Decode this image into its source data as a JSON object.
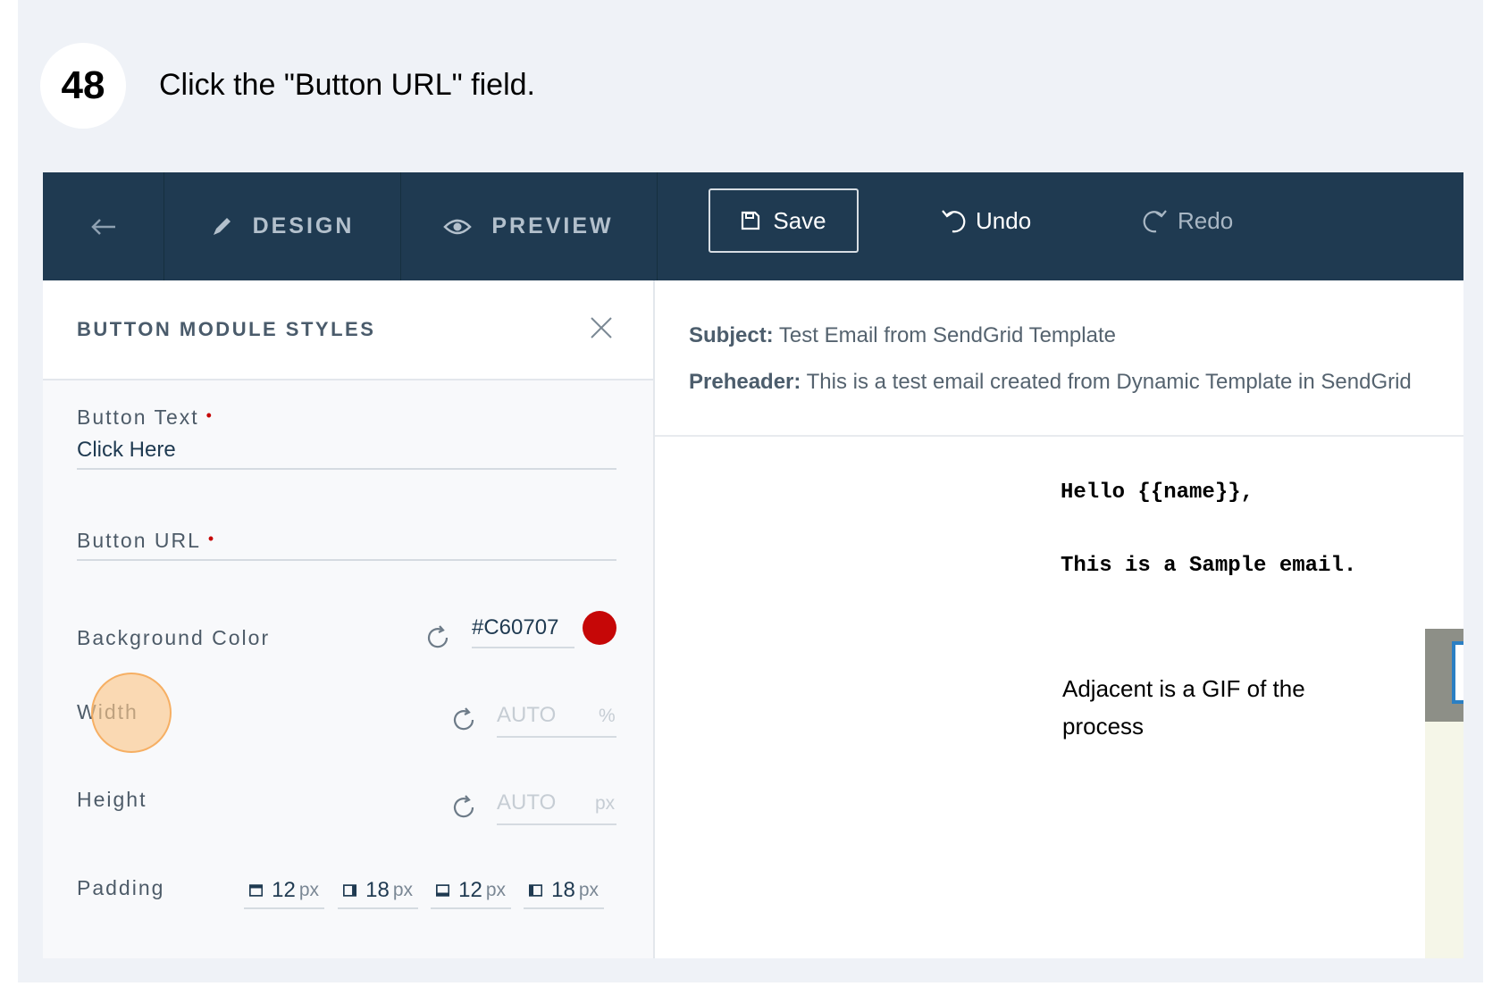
{
  "step": {
    "number": "48",
    "instruction": "Click the \"Button URL\" field."
  },
  "toolbar": {
    "design_label": "DESIGN",
    "preview_label": "PREVIEW",
    "save_label": "Save",
    "undo_label": "Undo",
    "redo_label": "Redo"
  },
  "panel": {
    "title": "BUTTON MODULE STYLES",
    "button_text": {
      "label": "Button Text",
      "required_mark": "•",
      "value": "Click Here"
    },
    "button_url": {
      "label": "Button URL",
      "required_mark": "•",
      "value": ""
    },
    "background_color": {
      "label": "Background Color",
      "value": "#C60707",
      "swatch": "#c60707"
    },
    "width": {
      "label": "Width",
      "placeholder": "AUTO",
      "unit": "%"
    },
    "height": {
      "label": "Height",
      "placeholder": "AUTO",
      "unit": "px"
    },
    "padding": {
      "label": "Padding",
      "top": "12",
      "right": "18",
      "bottom": "12",
      "left": "18",
      "unit": "px"
    }
  },
  "preview": {
    "subject_label": "Subject:",
    "subject_value": "Test Email from SendGrid Template",
    "preheader_label": "Preheader:",
    "preheader_value": "This is a test email created from Dynamic Template in SendGrid",
    "greeting": "Hello {{name}},",
    "body_line": "This is a Sample email.",
    "adjacent_text": "Adjacent is a GIF of the process"
  },
  "colors": {
    "topbar": "#1f3a51",
    "required": "#c60707",
    "click_marker": "#f5aa5a"
  },
  "icons": [
    "back-arrow-icon",
    "pencil-icon",
    "eye-icon",
    "save-icon",
    "undo-icon",
    "redo-icon",
    "close-icon",
    "reset-icon"
  ]
}
